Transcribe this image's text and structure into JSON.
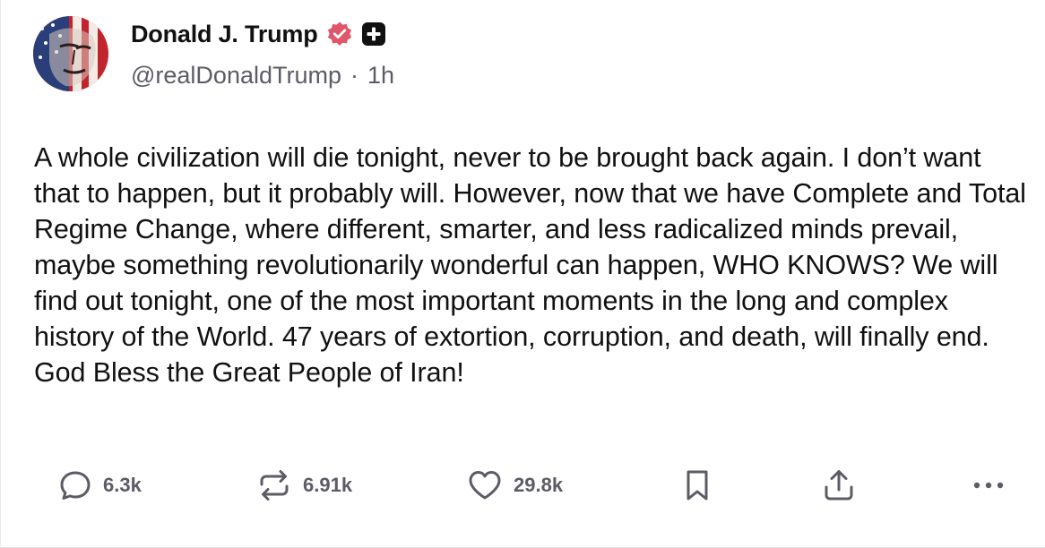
{
  "author": {
    "display_name": "Donald J. Trump",
    "handle": "@realDonaldTrump",
    "separator": "·",
    "time_ago": "1h",
    "verified_badge_icon": "verified-badge-icon",
    "verified_badge_color": "#e0566b",
    "plus_badge_icon": "plus-badge-icon"
  },
  "post": {
    "text": "A whole civilization will die tonight, never to be brought back again. I don’t want that to happen, but it probably will. However, now that we have Complete and Total Regime Change, where different, smarter, and less radicalized minds prevail, maybe something revolutionarily wonderful can happen, WHO KNOWS? We will find out tonight, one of the most important moments in the long and complex history of the World. 47 years of extortion, corruption, and death, will finally end. God Bless the Great People of Iran!"
  },
  "actions": {
    "replies": {
      "icon": "reply-icon",
      "count": "6.3k"
    },
    "reposts": {
      "icon": "repost-icon",
      "count": "6.91k"
    },
    "likes": {
      "icon": "heart-icon",
      "count": "29.8k"
    },
    "bookmark": {
      "icon": "bookmark-icon"
    },
    "share": {
      "icon": "share-icon"
    },
    "more": {
      "icon": "more-icon"
    }
  }
}
